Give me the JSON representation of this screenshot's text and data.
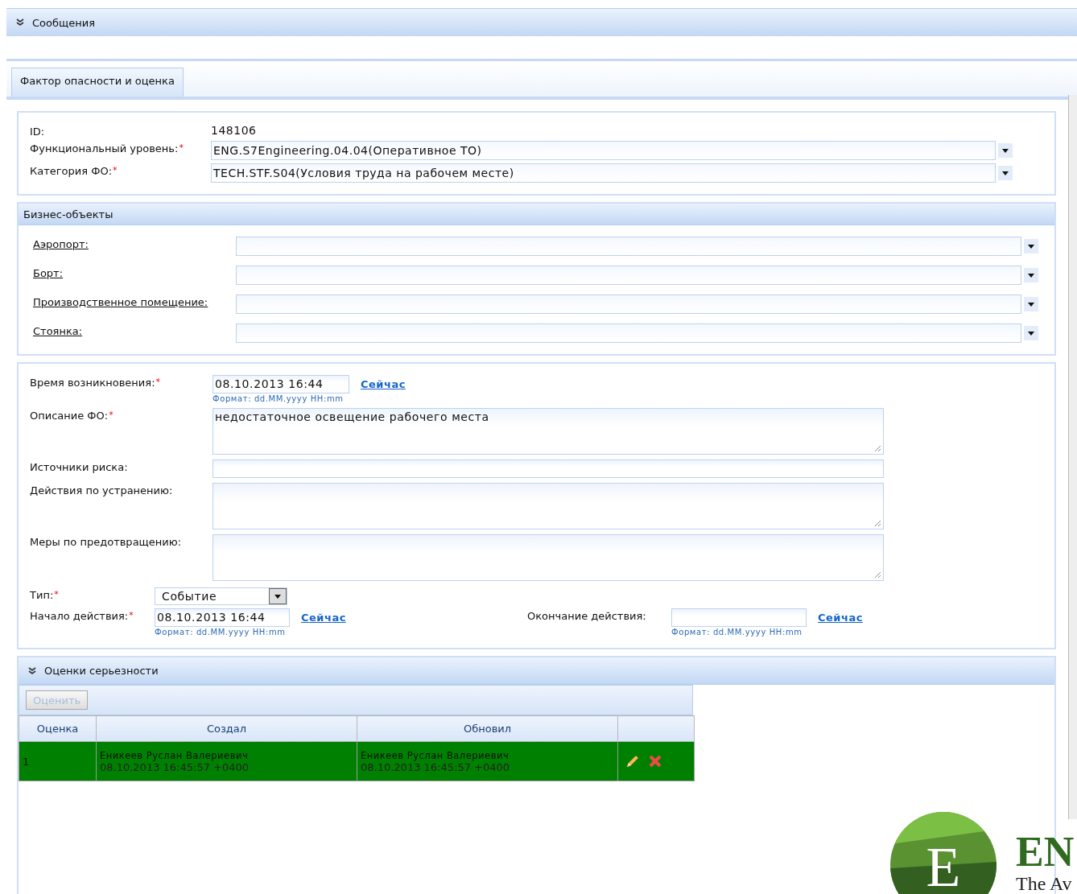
{
  "header": {
    "title": "Сообщения"
  },
  "tabs": [
    {
      "label": "Фактор опасности и оценка",
      "selected": true
    }
  ],
  "general": {
    "id_label": "ID:",
    "id_value": "148106",
    "fields": [
      {
        "label": "Функциональный уровень:",
        "required_mark": "*",
        "value": "ENG.S7Engineering.04.04(Оперативное ТО)"
      },
      {
        "label": "Категория ФО:",
        "required_mark": "*",
        "value": "TECH.STF.S04(Условия труда на рабочем месте)"
      }
    ]
  },
  "business_objects": {
    "title": "Бизнес-объекты",
    "fields": [
      {
        "label": "Аэропорт:"
      },
      {
        "label": "Борт:"
      },
      {
        "label": "Производственное помещение:"
      },
      {
        "label": "Стоянка:"
      }
    ]
  },
  "details": {
    "rows": [
      {
        "kind": "datetime",
        "label": "Время возникновения:",
        "required_mark": "*",
        "value": "08.10.2013 16:44",
        "link": "Сейчас",
        "hint": "Формат: dd.MM.yyyy HH:mm"
      },
      {
        "kind": "textarea",
        "label": "Описание ФО:",
        "required_mark": "*",
        "value": "недостаточное освещение рабочего места"
      },
      {
        "kind": "input",
        "label": "Источники риска:"
      },
      {
        "kind": "textarea",
        "label": "Действия по устранению:"
      },
      {
        "kind": "textarea",
        "label": "Меры по предотвращению:"
      }
    ],
    "type": {
      "label": "Тип:",
      "required_mark": "*",
      "value": "Событие"
    },
    "start": {
      "label": "Начало действия:",
      "required_mark": "*",
      "value": "08.10.2013 16:44",
      "link": "Сейчас",
      "hint": "Формат: dd.MM.yyyy HH:mm"
    },
    "end": {
      "label": "Окончание действия:",
      "link": "Сейчас",
      "hint": "Формат: dd.MM.yyyy HH:mm"
    }
  },
  "assessments": {
    "title": "Оценки серьезности",
    "button": {
      "label": "Оценить",
      "disabled": true
    },
    "columns": [
      "Оценка",
      "Создал",
      "Обновил"
    ],
    "rows": [
      {
        "score": "1",
        "created_by": "Еникеев Руслан Валериевич",
        "created_at": "08.10.2013 16:45:57 +0400",
        "updated_by": "Еникеев Руслан Валериевич",
        "updated_at": "08.10.2013 16:45:57 +0400",
        "selected": true
      }
    ]
  },
  "logo": {
    "letter": "E",
    "name": "EN",
    "tagline": "The Av"
  }
}
